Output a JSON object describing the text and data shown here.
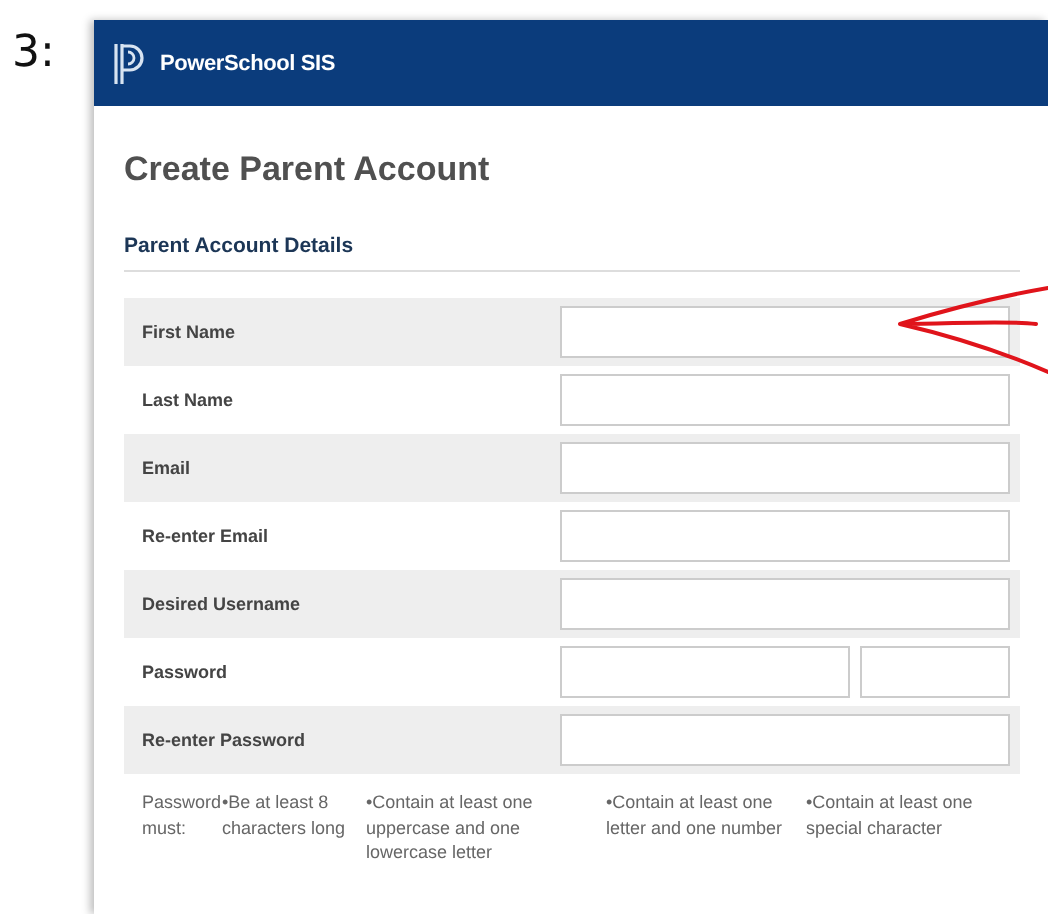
{
  "step_label": "3:",
  "header": {
    "brand": "PowerSchool SIS"
  },
  "page_title": "Create Parent Account",
  "section_title": "Parent Account Details",
  "fields": [
    {
      "label": "First Name",
      "kind": "text"
    },
    {
      "label": "Last Name",
      "kind": "text"
    },
    {
      "label": "Email",
      "kind": "text"
    },
    {
      "label": "Re-enter Email",
      "kind": "text"
    },
    {
      "label": "Desired Username",
      "kind": "text"
    },
    {
      "label": "Password",
      "kind": "split"
    },
    {
      "label": "Re-enter Password",
      "kind": "text"
    }
  ],
  "password_rules": {
    "label": "Password must:",
    "items": [
      "•Be at least 8 characters long",
      "•Contain at least one uppercase and one lowercase letter",
      "•Contain at least one letter and one number",
      "•Contain at least one special character"
    ]
  }
}
